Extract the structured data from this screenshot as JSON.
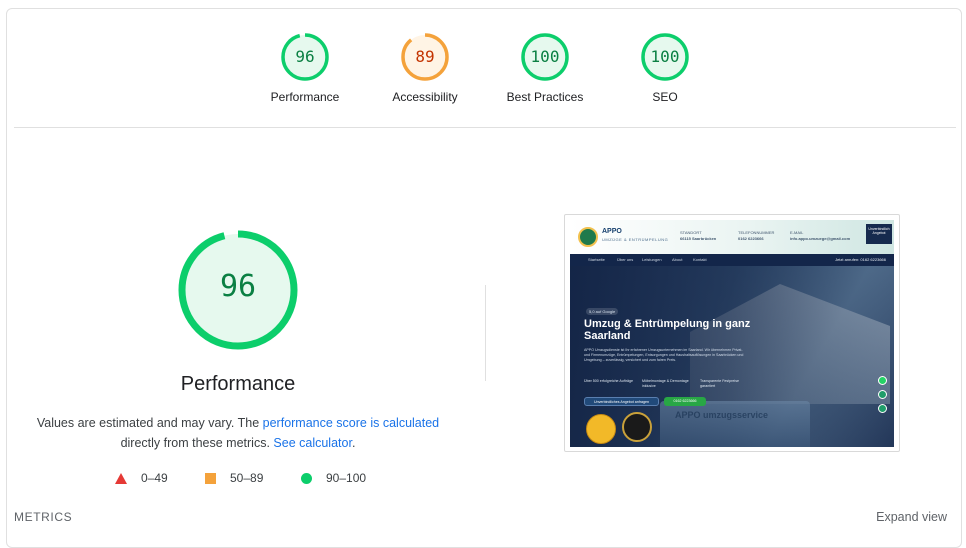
{
  "gauges": [
    {
      "score": "96",
      "label": "Performance",
      "level": 0.96,
      "color": "#0cce6b",
      "bg": "#e6f9ee",
      "text_color": "#0b8043"
    },
    {
      "score": "89",
      "label": "Accessibility",
      "level": 0.89,
      "color": "#f4a23b",
      "bg": "#fff4e5",
      "text_color": "#c33300"
    },
    {
      "score": "100",
      "label": "Best Practices",
      "level": 1.0,
      "color": "#0cce6b",
      "bg": "#e6f9ee",
      "text_color": "#0b8043"
    },
    {
      "score": "100",
      "label": "SEO",
      "level": 1.0,
      "color": "#0cce6b",
      "bg": "#e6f9ee",
      "text_color": "#0b8043"
    }
  ],
  "main": {
    "score": "96",
    "level": 0.96,
    "title": "Performance",
    "desc_prefix": "Values are estimated and may vary. The ",
    "desc_link1": "performance score is calculated",
    "desc_mid": "directly from these metrics. ",
    "desc_link2": "See calculator",
    "desc_suffix": "."
  },
  "legend": {
    "fail": "0–49",
    "average": "50–89",
    "pass": "90–100"
  },
  "screenshot": {
    "brand": "APPO",
    "brand_sub": "UMZÜGE & ENTRÜMPELUNG",
    "header_address_label": "STANDORT",
    "header_address": "66115 Saarbrücken",
    "header_phone_label": "TELEFONNUMMER",
    "header_phone": "0162 6223666",
    "header_email_label": "E-MAIL",
    "header_email": "info.appo.umzuege@gmail.com",
    "header_button": "Unverbindlich Angebot",
    "nav": [
      "Startseite",
      "Über uns",
      "Leistungen",
      "About",
      "Kontakt"
    ],
    "nav_phone": "Jetzt anrufen: 0162 6223666",
    "hero_badge": "5,0 auf Google",
    "hero_title": "Umzug & Entrümpelung in ganz Saarland",
    "hero_text": "APPO Umzugsdienste ist Ihr erfahrener Umzugsunternehmen im Saarland. Wir übernehmen Privat- und Firmenumzüge, Entrümpelungen, Entsorgungen und Haushaltsauflösungen in Saarbrücken und Umgebung – zuverlässig, versichert und zum fairen Preis.",
    "features": [
      "Über 500 erfolgreiche Aufträge",
      "Möbelmontage & Demontage inklusive",
      "Transparente Festpreise garantiert"
    ],
    "cta1": "Unverbindliches Angebot anfragen",
    "cta2": "0162 6223666",
    "truck_text": "APPO umzugsservice"
  },
  "footer": {
    "metrics": "METRICS",
    "expand": "Expand view"
  }
}
